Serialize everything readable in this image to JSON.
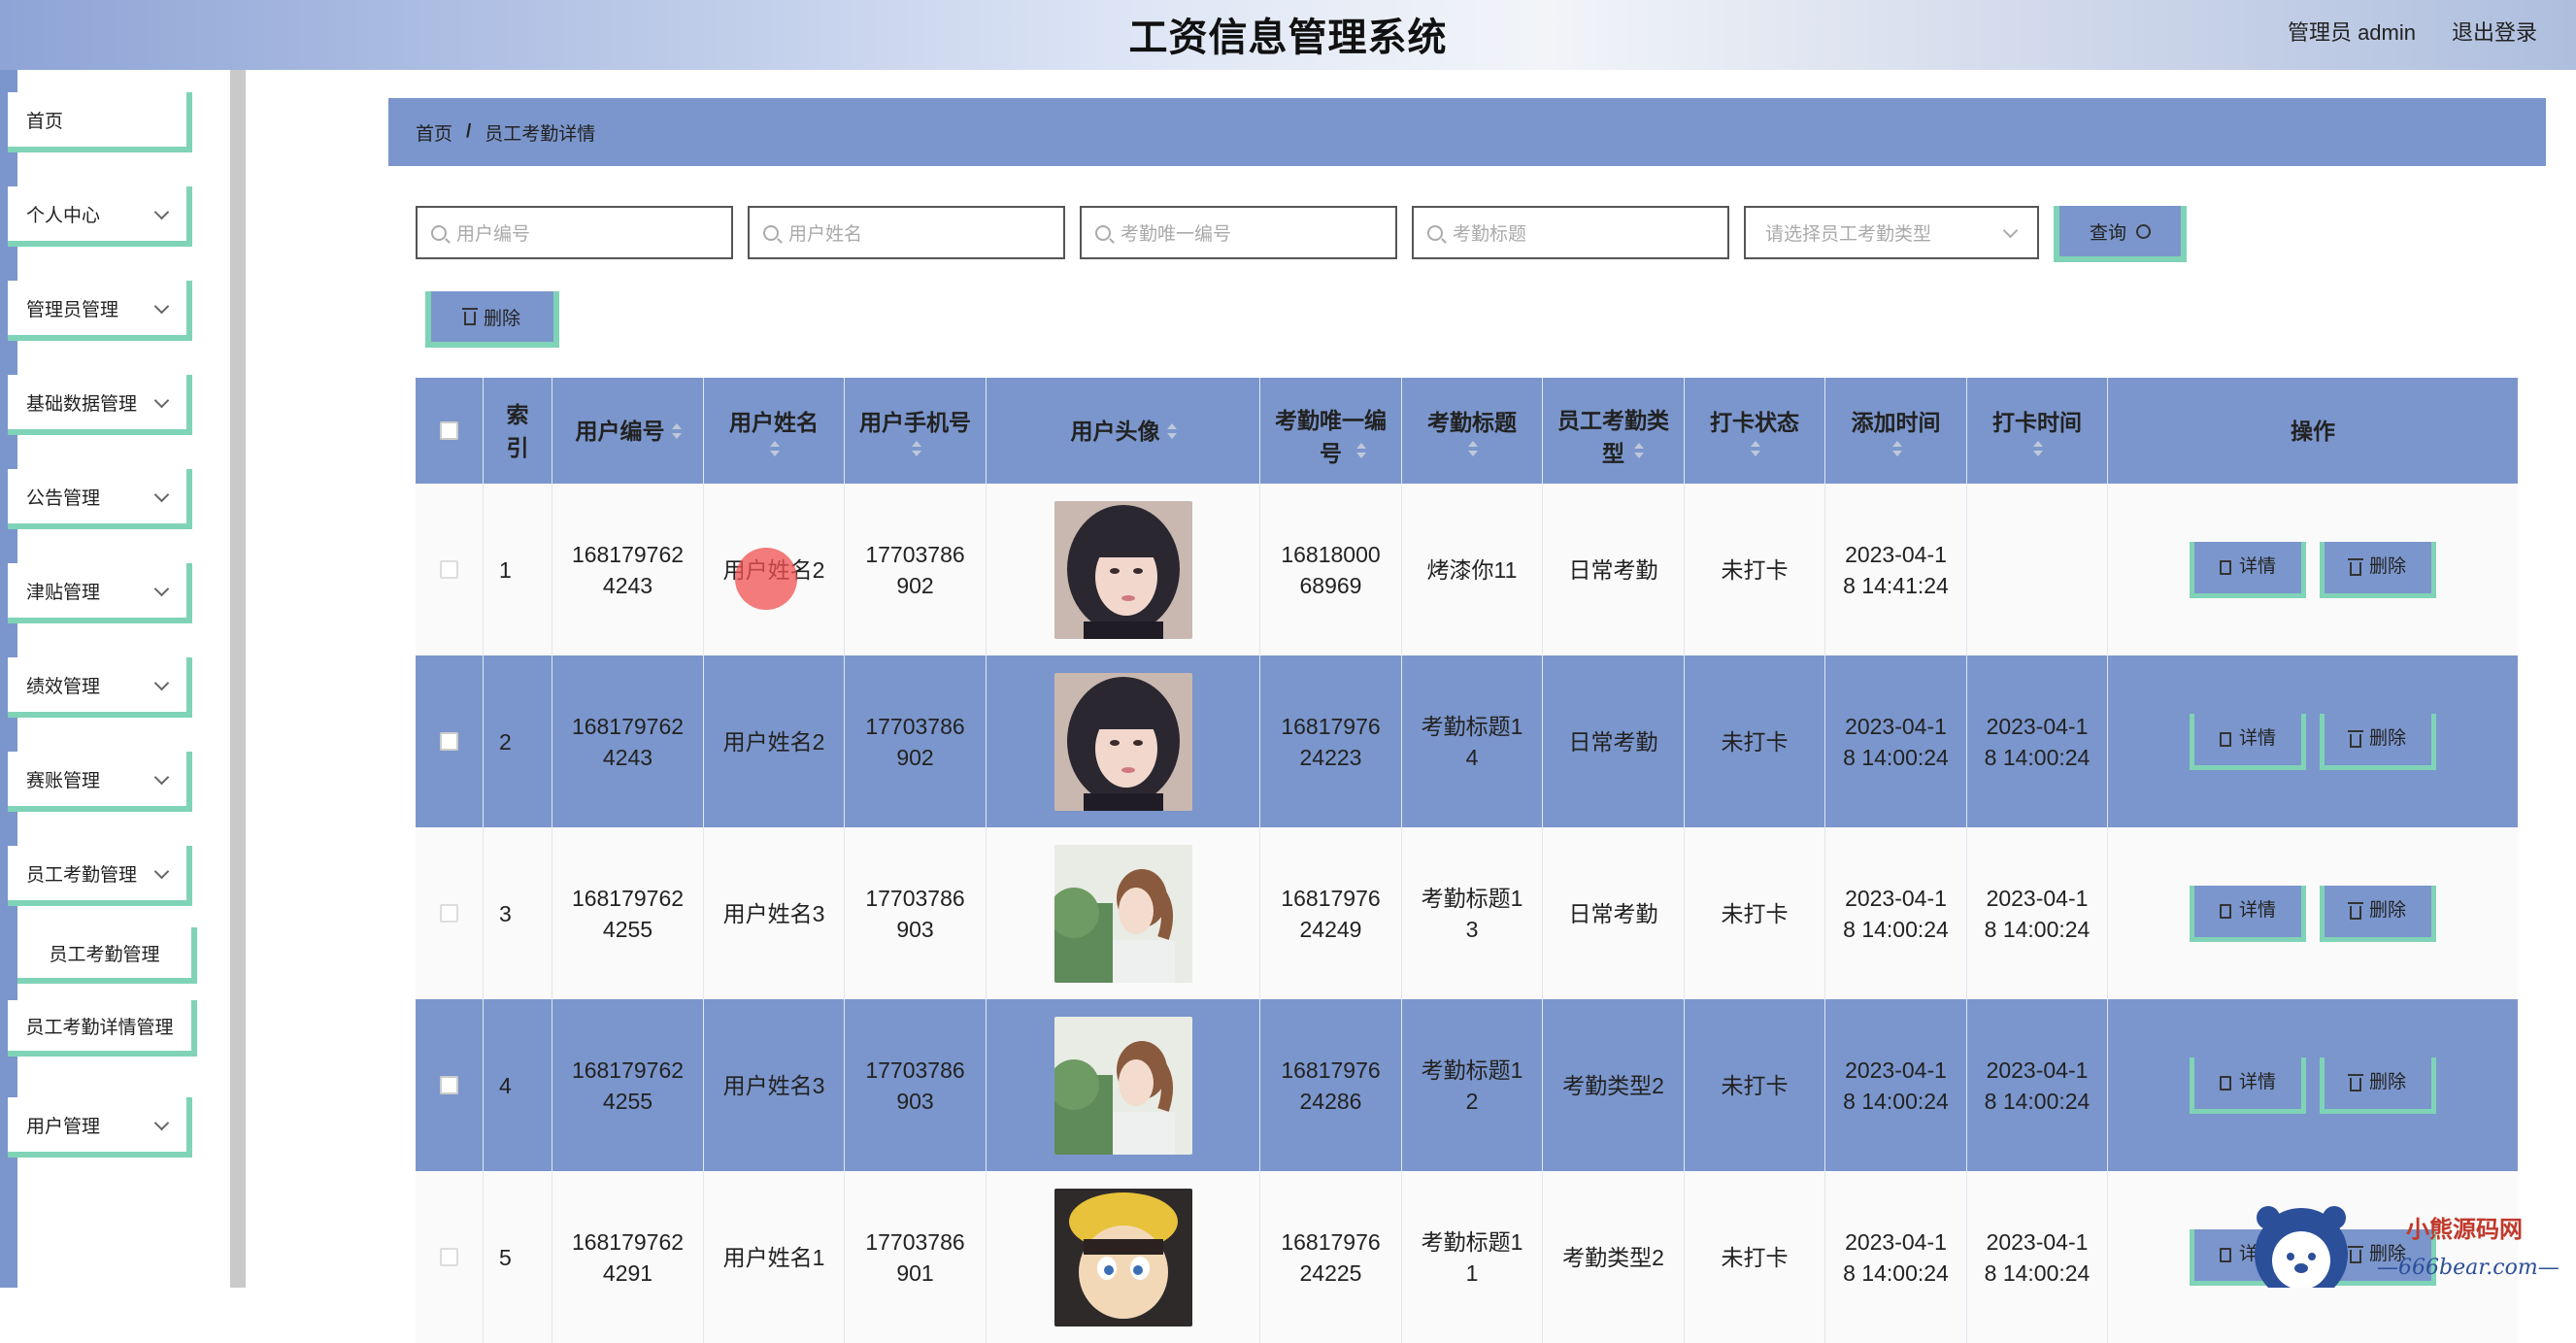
{
  "header": {
    "title": "工资信息管理系统",
    "user": "管理员 admin",
    "logout": "退出登录"
  },
  "sidebar": {
    "items": [
      {
        "label": "首页",
        "chev": false
      },
      {
        "label": "个人中心",
        "chev": true
      },
      {
        "label": "管理员管理",
        "chev": true
      },
      {
        "label": "基础数据管理",
        "chev": true
      },
      {
        "label": "公告管理",
        "chev": true
      },
      {
        "label": "津贴管理",
        "chev": true
      },
      {
        "label": "绩效管理",
        "chev": true
      },
      {
        "label": "赛账管理",
        "chev": true
      },
      {
        "label": "员工考勤管理",
        "chev": true
      }
    ],
    "subitems": [
      "员工考勤管理",
      "员工考勤详情管理"
    ],
    "last_item": "用户管理"
  },
  "breadcrumb": {
    "home": "首页",
    "sep": "/",
    "current": "员工考勤详情"
  },
  "search": {
    "user_no": "用户编号",
    "user_name": "用户姓名",
    "attend_no": "考勤唯一编号",
    "attend_title": "考勤标题",
    "type_select": "请选择员工考勤类型",
    "query_label": "查询"
  },
  "toolbar": {
    "delete_label": "删除"
  },
  "table": {
    "headers": {
      "index": "索引",
      "user_no": "用户编号",
      "user_name": "用户姓名",
      "phone": "用户手机号",
      "avatar": "用户头像",
      "attend_no": "考勤唯一编号",
      "title": "考勤标题",
      "type": "员工考勤类型",
      "status": "打卡状态",
      "added": "添加时间",
      "punch": "打卡时间",
      "actions": "操作"
    },
    "rows": [
      {
        "index": "1",
        "user_no": "1681797624243",
        "user_name": "用户姓名2",
        "phone": "17703786902",
        "avatar": "girl-dark-hair",
        "attend_no": "1681800068969",
        "title": "烤漆你11",
        "type": "日常考勤",
        "status": "未打卡",
        "added": "2023-04-18 14:41:24",
        "punch": ""
      },
      {
        "index": "2",
        "user_no": "1681797624243",
        "user_name": "用户姓名2",
        "phone": "17703786902",
        "avatar": "girl-dark-hair",
        "attend_no": "1681797624223",
        "title": "考勤标题14",
        "type": "日常考勤",
        "status": "未打卡",
        "added": "2023-04-18 14:00:24",
        "punch": "2023-04-18 14:00:24"
      },
      {
        "index": "3",
        "user_no": "1681797624255",
        "user_name": "用户姓名3",
        "phone": "17703786903",
        "avatar": "girl-outdoor",
        "attend_no": "1681797624249",
        "title": "考勤标题13",
        "type": "日常考勤",
        "status": "未打卡",
        "added": "2023-04-18 14:00:24",
        "punch": "2023-04-18 14:00:24"
      },
      {
        "index": "4",
        "user_no": "1681797624255",
        "user_name": "用户姓名3",
        "phone": "17703786903",
        "avatar": "girl-outdoor",
        "attend_no": "1681797624286",
        "title": "考勤标题12",
        "type": "考勤类型2",
        "status": "未打卡",
        "added": "2023-04-18 14:00:24",
        "punch": "2023-04-18 14:00:24"
      },
      {
        "index": "5",
        "user_no": "1681797624291",
        "user_name": "用户姓名1",
        "phone": "17703786901",
        "avatar": "cartoon-boy",
        "attend_no": "1681797624225",
        "title": "考勤标题11",
        "type": "考勤类型2",
        "status": "未打卡",
        "added": "2023-04-18 14:00:24",
        "punch": "2023-04-18 14:00:24"
      }
    ],
    "detail_label": "详情",
    "delete_label": "删除"
  },
  "watermark": {
    "brand": "小熊源码网",
    "url": "—666bear.com—"
  },
  "colors": {
    "accent": "#7b96cc",
    "border_accent": "#7fd3b6",
    "header_dark": "#8ea4d6"
  }
}
